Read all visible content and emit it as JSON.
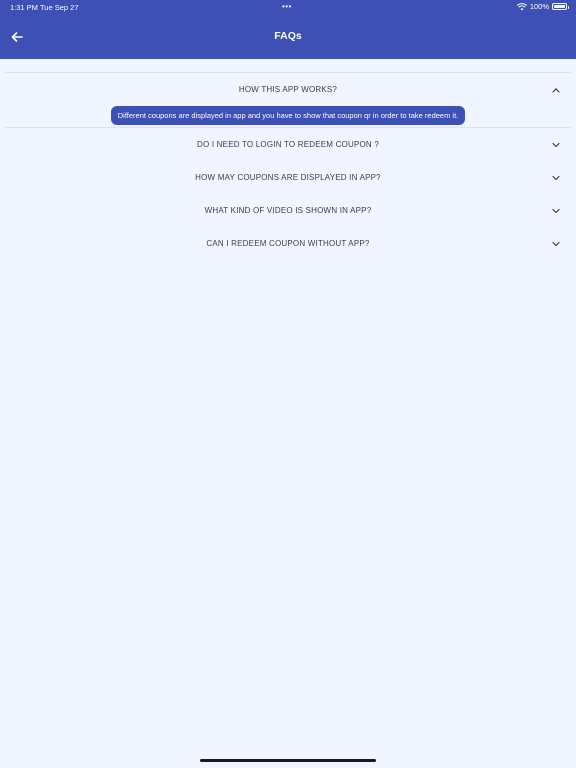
{
  "status_bar": {
    "time": "1:31 PM",
    "date": "Tue Sep 27",
    "dots": "•••",
    "battery": "100%"
  },
  "header": {
    "title": "FAQs",
    "back_icon": "arrow-left-icon"
  },
  "faqs": [
    {
      "question": "HOW THIS APP WORKS?",
      "answer": "Different coupons are displayed in app and you have to show that coupon qr in order to take redeem it.",
      "expanded": true
    },
    {
      "question": "DO I NEED TO LOGIN TO REDEEM COUPON ?",
      "expanded": false
    },
    {
      "question": "HOW MAY COUPONS ARE DISPLAYED IN APP?",
      "expanded": false
    },
    {
      "question": "WHAT KIND OF VIDEO IS SHOWN IN APP?",
      "expanded": false
    },
    {
      "question": "CAN I REDEEM COUPON WITHOUT APP?",
      "expanded": false
    }
  ],
  "colors": {
    "header_bg": "#3e50b6",
    "page_bg": "#f0f5ff",
    "text": "#3d3d4a"
  }
}
